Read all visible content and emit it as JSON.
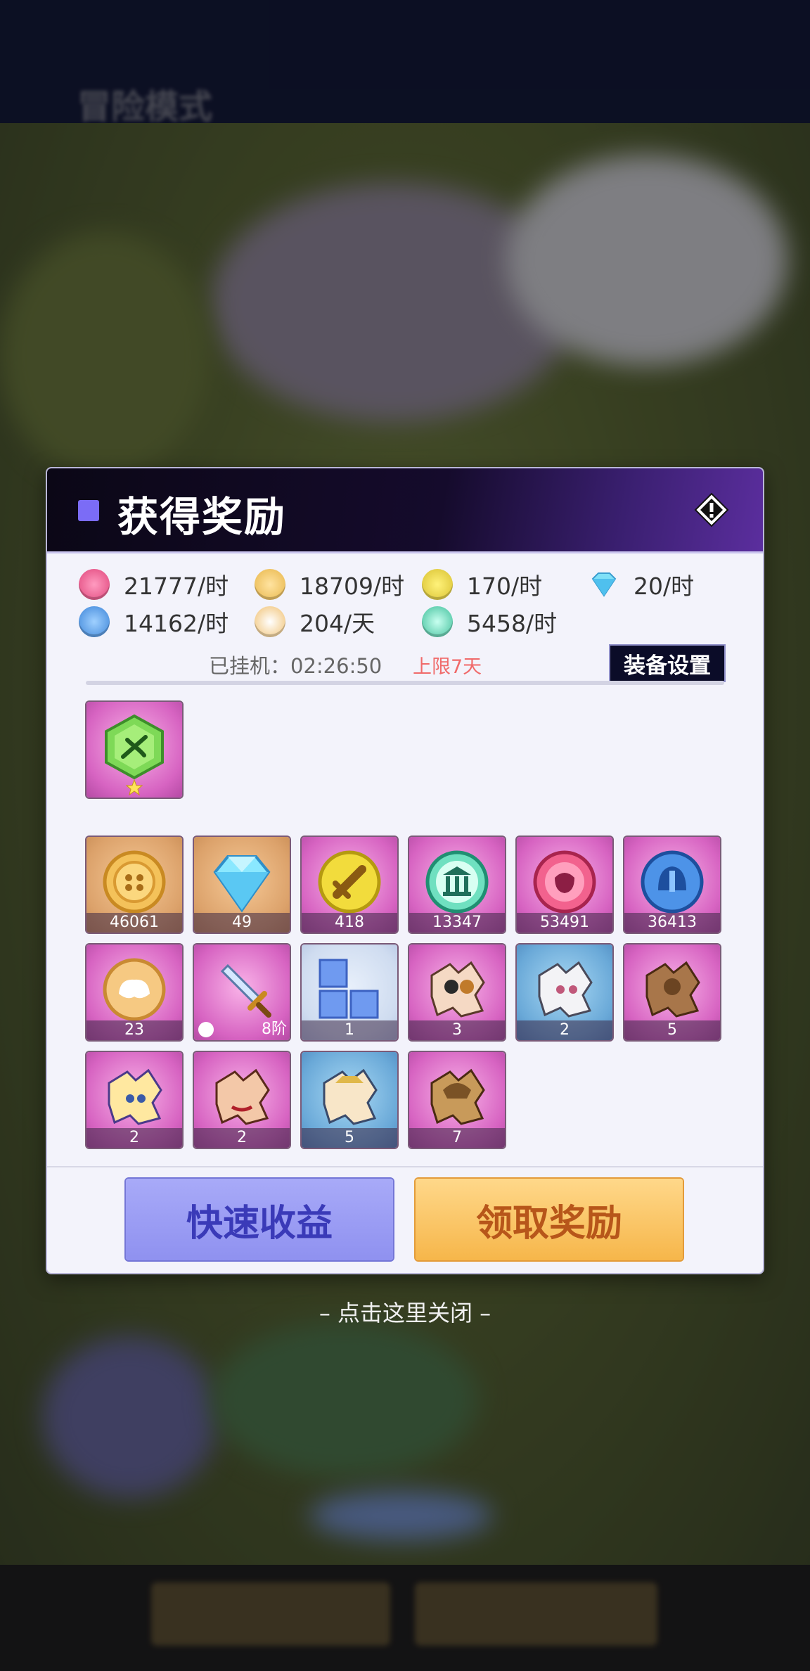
{
  "background": {
    "mode_title": "冒险模式"
  },
  "dialog": {
    "title": "获得奖励",
    "info_icon": "info-icon",
    "rates": [
      {
        "icon": "hero-exp-icon",
        "color": "#e0457b",
        "text": "21777/时"
      },
      {
        "icon": "gold-coin-icon",
        "color": "#e8b64a",
        "text": "18709/时"
      },
      {
        "icon": "sword-coin-icon",
        "color": "#d8c030",
        "text": "170/时"
      },
      {
        "icon": "diamond-icon",
        "color": "#6fd3f5",
        "text": "20/时"
      },
      {
        "icon": "helmet-coin-icon",
        "color": "#3c84d8",
        "text": "14162/时"
      },
      {
        "icon": "dust-icon",
        "color": "#f0c070",
        "text": "204/天"
      },
      {
        "icon": "guild-coin-icon",
        "color": "#3fbf9a",
        "text": "5458/时"
      }
    ],
    "idle_time": "已挂机：02:26:50",
    "idle_limit": "上限7天",
    "equip_settings_label": "装备设置",
    "featured_item": {
      "icon": "green-gem-icon",
      "stars": 1
    },
    "items": [
      {
        "icon": "gold-coin-icon",
        "bg": "orange",
        "count": "46061"
      },
      {
        "icon": "diamond-icon",
        "bg": "orange",
        "count": "49"
      },
      {
        "icon": "sword-coin-icon",
        "bg": "pink",
        "count": "418"
      },
      {
        "icon": "guild-coin-icon",
        "bg": "pink",
        "count": "13347"
      },
      {
        "icon": "hero-exp-icon",
        "bg": "pink",
        "count": "53491"
      },
      {
        "icon": "helmet-coin-icon",
        "bg": "pink",
        "count": "36413"
      },
      {
        "icon": "dust-icon",
        "bg": "pink",
        "count": "23"
      },
      {
        "icon": "sword-equipment-icon",
        "bg": "pink",
        "count": "8阶"
      },
      {
        "icon": "blue-blocks-icon",
        "bg": "light",
        "count": "1"
      },
      {
        "icon": "hero-shard-icon",
        "bg": "pink",
        "count": "3"
      },
      {
        "icon": "hero-shard-icon",
        "bg": "blue",
        "count": "2"
      },
      {
        "icon": "hero-shard-icon",
        "bg": "pink",
        "count": "5"
      },
      {
        "icon": "hero-shard-icon",
        "bg": "pink",
        "count": "2"
      },
      {
        "icon": "hero-shard-icon",
        "bg": "pink",
        "count": "2"
      },
      {
        "icon": "hero-shard-icon",
        "bg": "blue",
        "count": "5"
      },
      {
        "icon": "hero-shard-icon",
        "bg": "pink",
        "count": "7"
      }
    ],
    "quick_earn_label": "快速收益",
    "claim_label": "领取奖励"
  },
  "close_hint": "– 点击这里关闭 –"
}
